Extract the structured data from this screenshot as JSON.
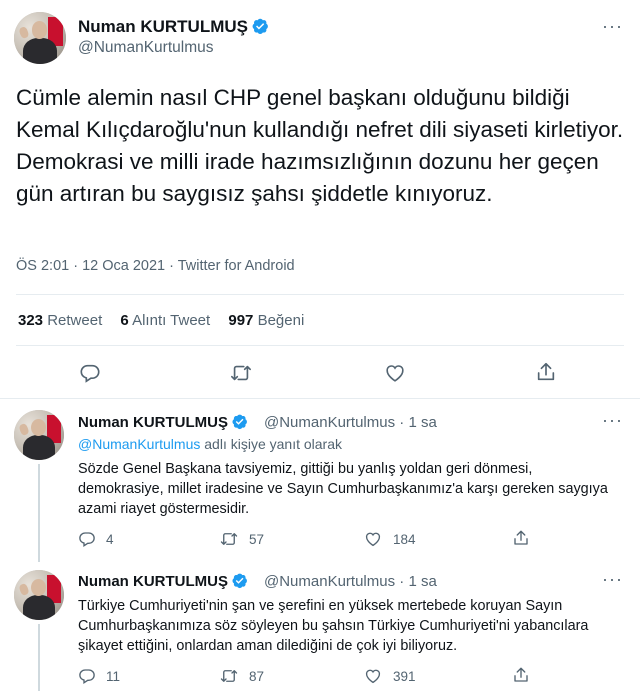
{
  "main_tweet": {
    "author_name": "Numan KURTULMUŞ",
    "author_handle": "@NumanKurtulmus",
    "text": "Cümle alemin nasıl CHP genel başkanı olduğunu bildiği Kemal Kılıçdaroğlu'nun kullandığı nefret dili siyaseti kirletiyor. Demokrasi ve milli irade hazımsızlığının dozunu her geçen gün artıran bu saygısız şahsı şiddetle kınıyoruz.",
    "timestamp": "ÖS 2:01 · 12 Oca 2021 · Twitter for Android",
    "stats": {
      "retweets_count": "323",
      "retweets_label": "Retweet",
      "quotes_count": "6",
      "quotes_label": "Alıntı Tweet",
      "likes_count": "997",
      "likes_label": "Beğeni"
    },
    "more_label": "···"
  },
  "replies": [
    {
      "author_name": "Numan KURTULMUŞ",
      "author_handle": "@NumanKurtulmus",
      "time": "· 1 sa",
      "reply_to_link": "@NumanKurtulmus",
      "reply_to_suffix": " adlı kişiye yanıt olarak",
      "text": "Sözde Genel Başkana tavsiyemiz, gittiği bu yanlış yoldan geri dönmesi, demokrasiye, millet iradesine ve Sayın Cumhurbaşkanımız'a karşı gereken saygıya azami riayet göstermesidir.",
      "replies_count": "4",
      "retweets_count": "57",
      "likes_count": "184",
      "more_label": "···"
    },
    {
      "author_name": "Numan KURTULMUŞ",
      "author_handle": "@NumanKurtulmus",
      "time": "· 1 sa",
      "text": "Türkiye Cumhuriyeti'nin şan ve şerefini en yüksek mertebede koruyan Sayın Cumhurbaşkanımıza söz söyleyen bu şahsın Türkiye Cumhuriyeti'ni yabancılara şikayet ettiğini, onlardan aman dilediğini de çok iyi biliyoruz.",
      "replies_count": "11",
      "retweets_count": "87",
      "likes_count": "391",
      "more_label": "···"
    }
  ],
  "icons": {
    "verified": "verified-badge-icon",
    "reply": "reply-icon",
    "retweet": "retweet-icon",
    "like": "like-icon",
    "share": "share-icon",
    "more": "more-icon"
  },
  "colors": {
    "accent": "#1d9bf0",
    "secondary_text": "#536471",
    "divider": "#e6ecf0"
  }
}
